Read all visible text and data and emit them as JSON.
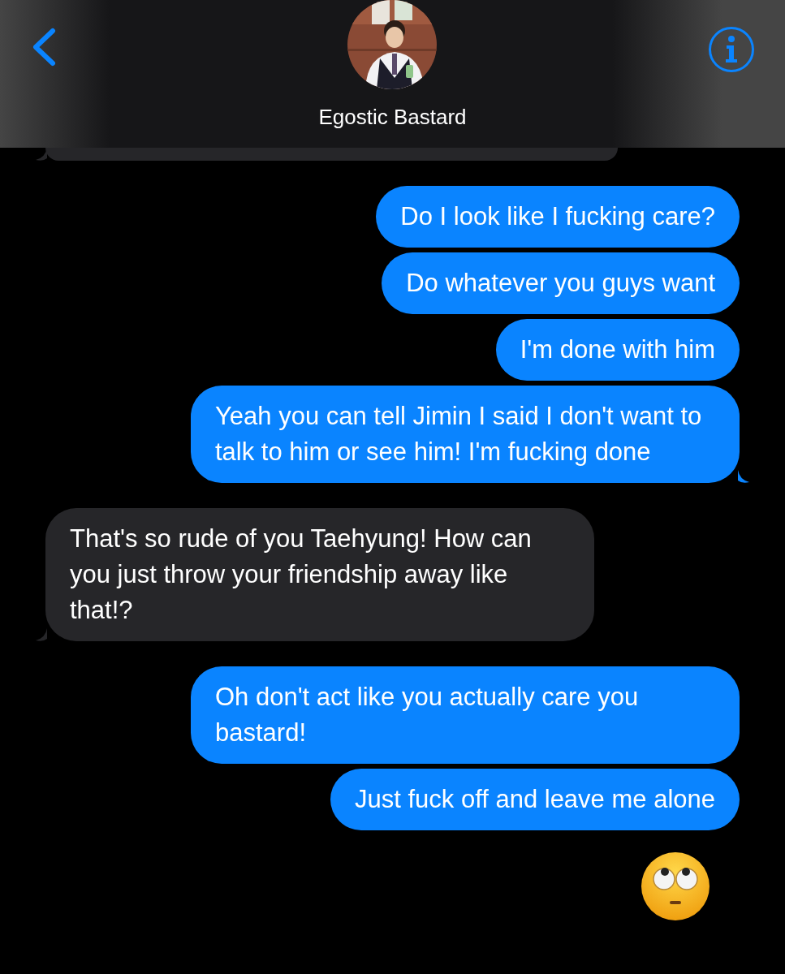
{
  "header": {
    "contact_name": "Egostic Bastard"
  },
  "messages": [
    {
      "outgoing": false,
      "kind": "cut",
      "tail": true
    },
    {
      "outgoing": true,
      "kind": "text",
      "text": "Do I look like I fucking care?",
      "tail": false
    },
    {
      "outgoing": true,
      "kind": "text",
      "text": "Do whatever you guys want",
      "tail": false
    },
    {
      "outgoing": true,
      "kind": "text",
      "text": "I'm done with him",
      "tail": false
    },
    {
      "outgoing": true,
      "kind": "text",
      "text": "Yeah you can tell Jimin I said I don't want to talk to him or see him! I'm fucking done",
      "tail": true
    },
    {
      "outgoing": false,
      "kind": "text",
      "text": "That's so rude of you Taehyung! How can you just throw your friendship away like that!?",
      "tail": true
    },
    {
      "outgoing": true,
      "kind": "text",
      "text": "Oh don't act like you actually care you bastard!",
      "tail": false
    },
    {
      "outgoing": true,
      "kind": "text",
      "text": "Just fuck off and leave me alone",
      "tail": false
    },
    {
      "kind": "emoji"
    }
  ]
}
